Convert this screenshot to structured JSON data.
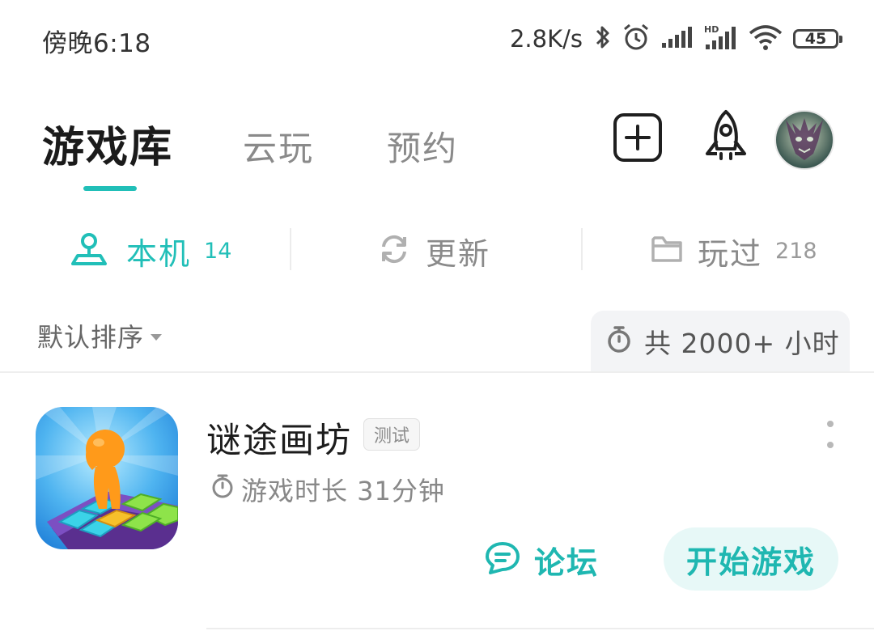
{
  "status_bar": {
    "time": "傍晚6:18",
    "net_speed": "2.8K/s",
    "battery": "45",
    "icons": [
      "bluetooth-icon",
      "alarm-icon",
      "signal-icon",
      "signal-hd-icon",
      "wifi-icon",
      "battery-icon"
    ]
  },
  "header": {
    "tabs": [
      {
        "label": "游戏库",
        "active": true
      },
      {
        "label": "云玩",
        "active": false
      },
      {
        "label": "预约",
        "active": false
      }
    ],
    "icons": [
      "add-icon",
      "rocket-icon",
      "avatar"
    ]
  },
  "sub_tabs": [
    {
      "label": "本机",
      "count": "14",
      "icon": "location-pin-icon",
      "active": true
    },
    {
      "label": "更新",
      "count": "",
      "icon": "refresh-icon",
      "active": false
    },
    {
      "label": "玩过",
      "count": "218",
      "icon": "folder-icon",
      "active": false
    }
  ],
  "sort": {
    "label": "默认排序"
  },
  "total": {
    "text": "共 2000+ 小时",
    "icon": "stopwatch-icon"
  },
  "games": [
    {
      "title": "谜途画坊",
      "badge": "测试",
      "playtime": "游戏时长 31分钟",
      "forum_label": "论坛",
      "start_label": "开始游戏"
    }
  ],
  "colors": {
    "accent": "#21bfb8",
    "start_bg": "#e7f8f7",
    "inactive": "#8a8a8a"
  }
}
